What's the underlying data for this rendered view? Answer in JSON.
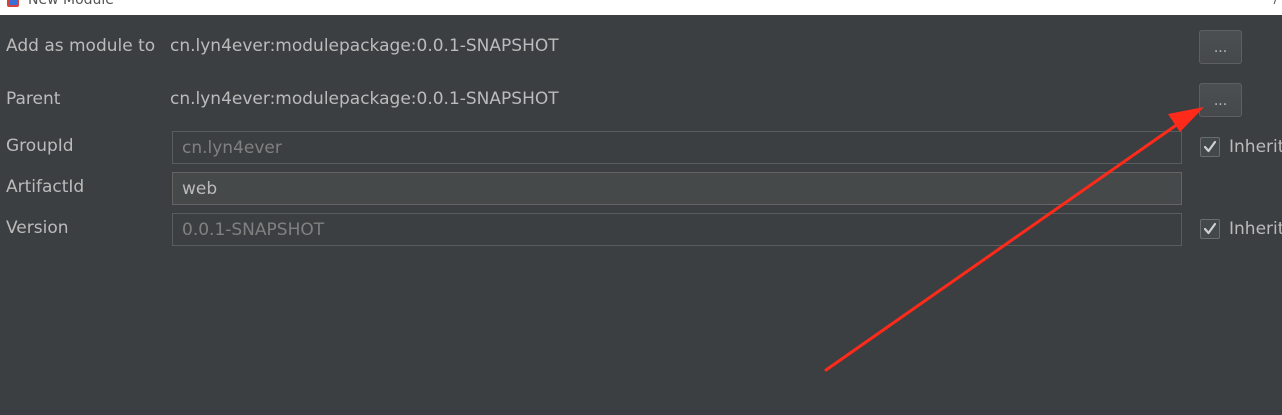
{
  "window": {
    "title": "New Module",
    "close_icon": "close-icon"
  },
  "form": {
    "add_as_module": {
      "label": "Add as module to",
      "value": "cn.lyn4ever:modulepackage:0.0.1-SNAPSHOT",
      "button_label": "..."
    },
    "parent": {
      "label": "Parent",
      "value": "cn.lyn4ever:modulepackage:0.0.1-SNAPSHOT",
      "button_label": "..."
    },
    "group_id": {
      "label": "GroupId",
      "value": "cn.lyn4ever",
      "inherit_label": "Inherit",
      "inherit_checked": true
    },
    "artifact_id": {
      "label": "ArtifactId",
      "value": "web"
    },
    "version": {
      "label": "Version",
      "value": "0.0.1-SNAPSHOT",
      "inherit_label": "Inherit",
      "inherit_checked": true
    }
  },
  "annotation": {
    "type": "arrow",
    "color": "#ff2a1a",
    "points_to": "parent-browse-button"
  }
}
